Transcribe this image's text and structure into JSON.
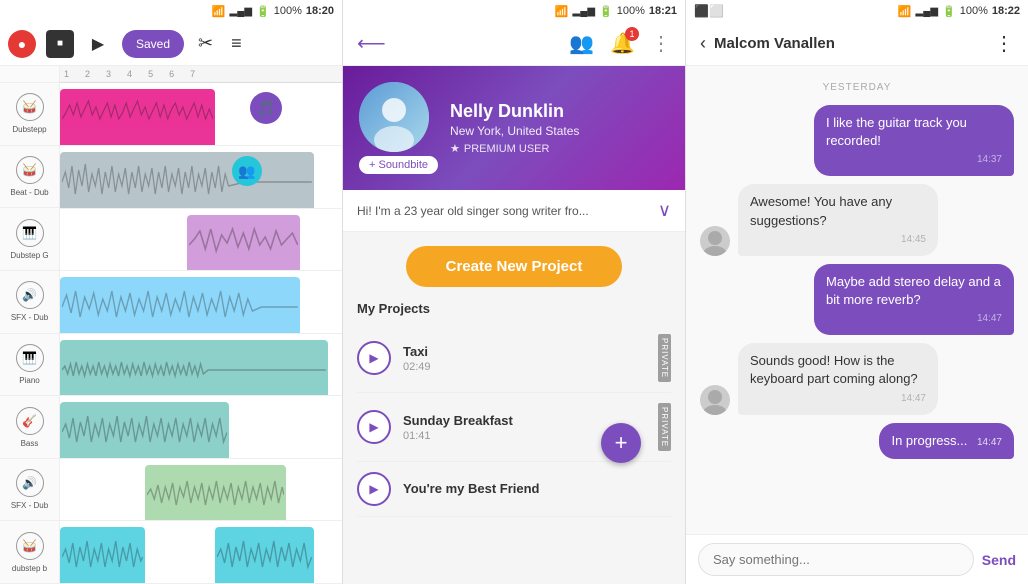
{
  "panel1": {
    "statusBar": {
      "signal": "wifi",
      "battery": "100%",
      "time": "18:20"
    },
    "toolbar": {
      "savedLabel": "Saved"
    },
    "ruler": [
      "1",
      "2",
      "3",
      "4",
      "5",
      "6",
      "7"
    ],
    "tracks": [
      {
        "name": "Dubstepp",
        "icon": "🥁",
        "color": "#e91e8c",
        "type": "pink"
      },
      {
        "name": "Beat - Dub",
        "icon": "🥁",
        "color": "#b0bec5",
        "type": "gray"
      },
      {
        "name": "Dubstep G",
        "icon": "🎹",
        "color": "#ce93d8",
        "type": "purple"
      },
      {
        "name": "SFX - Dub",
        "icon": "🔊",
        "color": "#81d4fa",
        "type": "blue"
      },
      {
        "name": "Piano",
        "icon": "🎹",
        "color": "#80cbc4",
        "type": "teal"
      },
      {
        "name": "Bass",
        "icon": "🎸",
        "color": "#80cbc4",
        "type": "teal"
      },
      {
        "name": "SFX - Dub",
        "icon": "🔊",
        "color": "#a5d6a7",
        "type": "green"
      },
      {
        "name": "dubstep b",
        "icon": "🥁",
        "color": "#80cbc4",
        "type": "teal2"
      }
    ]
  },
  "panel2": {
    "statusBar": {
      "battery": "100%",
      "time": "18:21"
    },
    "profile": {
      "name": "Nelly Dunklin",
      "location": "New York, United States",
      "badge": "PREMIUM USER",
      "bio": "Hi! I'm a 23 year old singer song writer fro...",
      "soundbiteLabel": "+ Soundbite"
    },
    "createProjectBtn": "Create New Project",
    "projectsTitle": "My Projects",
    "projects": [
      {
        "name": "Taxi",
        "duration": "02:49",
        "private": true
      },
      {
        "name": "Sunday Breakfast",
        "duration": "01:41",
        "private": true
      },
      {
        "name": "You're my Best Friend",
        "duration": "",
        "private": false
      }
    ]
  },
  "panel3": {
    "statusBar": {
      "battery": "100%",
      "time": "18:22"
    },
    "chat": {
      "title": "Malcom Vanallen",
      "dateDivider": "YESTERDAY",
      "messages": [
        {
          "id": 1,
          "type": "sent",
          "text": "I like the guitar track you recorded!",
          "time": "14:37"
        },
        {
          "id": 2,
          "type": "received",
          "text": "Awesome! You have any suggestions?",
          "time": "14:45"
        },
        {
          "id": 3,
          "type": "sent",
          "text": "Maybe add stereo delay and a bit more reverb?",
          "time": "14:47"
        },
        {
          "id": 4,
          "type": "received",
          "text": "Sounds good! How is the keyboard part coming along?",
          "time": "14:47"
        },
        {
          "id": 5,
          "type": "sent",
          "text": "In progress...",
          "time": "14:47"
        }
      ],
      "inputPlaceholder": "Say something...",
      "sendLabel": "Send"
    }
  }
}
